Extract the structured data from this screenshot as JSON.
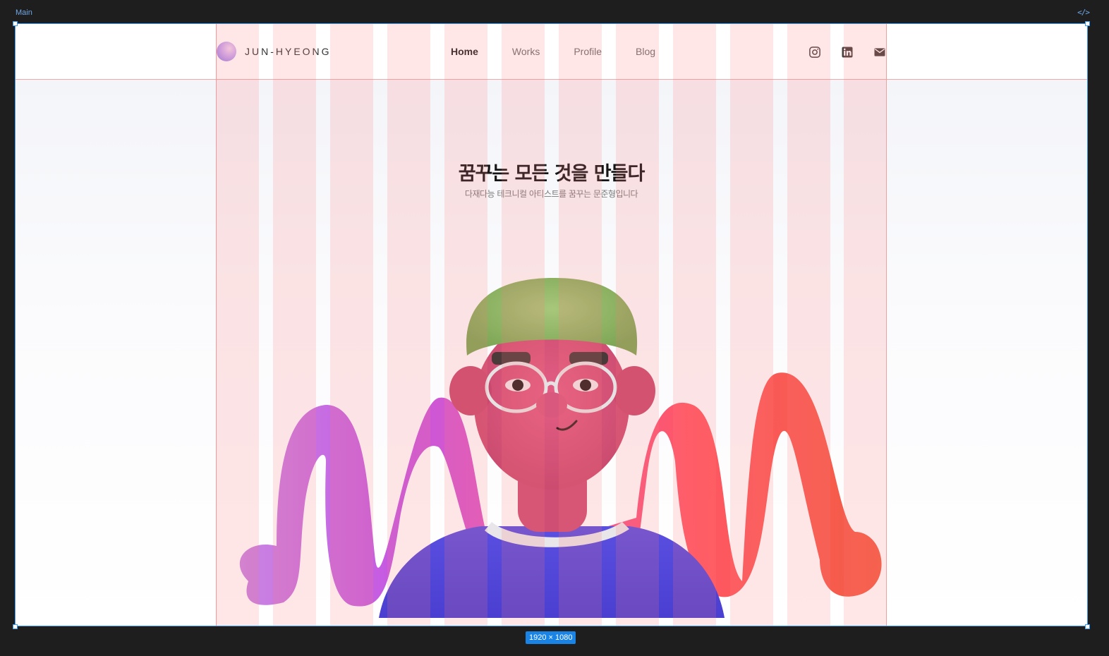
{
  "editor": {
    "frame_label": "Main",
    "code_icon": "</>",
    "frame_size": "1920 × 1080"
  },
  "site": {
    "logo_text": "JUN-HYEONG",
    "nav": [
      {
        "label": "Home",
        "active": true
      },
      {
        "label": "Works",
        "active": false
      },
      {
        "label": "Profile",
        "active": false
      },
      {
        "label": "Blog",
        "active": false
      }
    ],
    "socials": [
      "instagram-icon",
      "linkedin-icon",
      "mail-icon"
    ],
    "hero": {
      "title": "꿈꾸는 모든 것을 만들다",
      "subtitle": "다재다능 테크니컬 아티스트를 꿈꾸는 문준형입니다"
    }
  },
  "grid": {
    "columns": 12,
    "color": "#ff7878"
  },
  "colors": {
    "accent": "#3d9bf0",
    "badge": "#1a84e6",
    "text_primary": "#151515",
    "text_muted": "#7a7a7a"
  }
}
